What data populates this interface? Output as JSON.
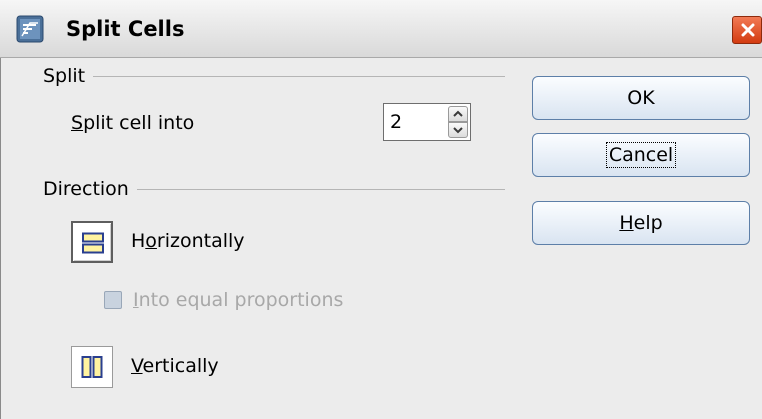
{
  "window": {
    "title": "Split Cells",
    "icon": "app-document-icon",
    "close_icon": "close-icon"
  },
  "split_group": {
    "label": "Split",
    "field_label_pre": "",
    "field_label_mnemonic": "S",
    "field_label_post": "plit cell into",
    "value": "2"
  },
  "direction_group": {
    "label": "Direction",
    "horizontal_pre": "H",
    "horizontal_mnemonic": "o",
    "horizontal_post": "rizontally",
    "equal_mnemonic": "I",
    "equal_post": "nto equal proportions",
    "vertical_mnemonic": "V",
    "vertical_post": "ertically",
    "selected": "horizontal"
  },
  "buttons": {
    "ok": "OK",
    "cancel": "Cancel",
    "help_mnemonic": "H",
    "help_post": "elp"
  },
  "colors": {
    "icon_yellow": "#fff3a0",
    "icon_outline": "#2a3f8f",
    "close_red": "#d33b10"
  }
}
